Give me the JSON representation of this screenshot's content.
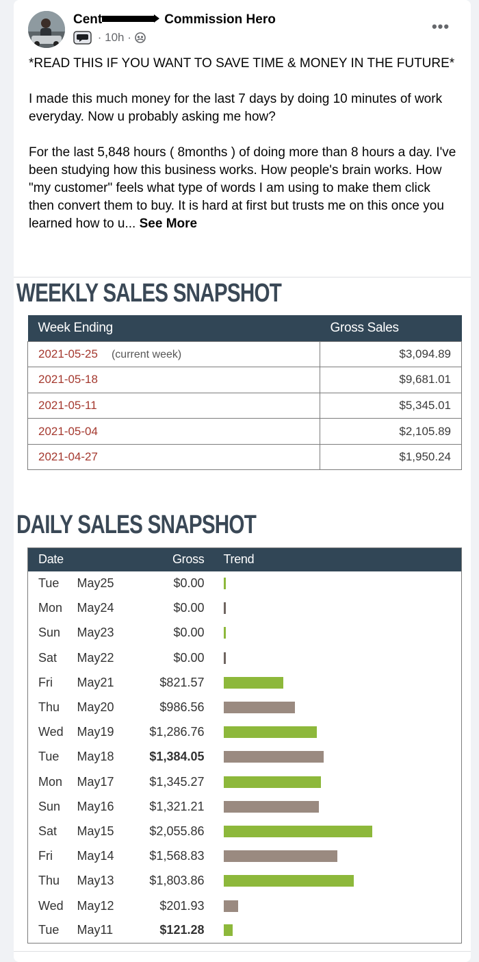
{
  "post": {
    "author_prefix": "Cent",
    "group": "Commission Hero",
    "time": "10h",
    "more_label": "•••",
    "paragraphs": [
      "*READ THIS IF YOU WANT TO SAVE TIME & MONEY IN THE FUTURE*",
      "I made this much money for the last 7 days by doing 10 minutes of work everyday. Now u probably asking me how?",
      "For the last 5,848 hours ( 8months ) of doing more than 8 hours a day. I've been studying how this business works. How people's brain works. How \"my customer\" feels what type of words I am using to make them click then convert them to buy. It is hard at first but trusts me on this once you learned how to u..."
    ],
    "see_more": "See More"
  },
  "weekly": {
    "title": "WEEKLY SALES SNAPSHOT",
    "headers": [
      "Week Ending",
      "Gross Sales"
    ],
    "current_note": "(current week)",
    "rows": [
      {
        "week": "2021-05-25",
        "gross": "$3,094.89"
      },
      {
        "week": "2021-05-18",
        "gross": "$9,681.01"
      },
      {
        "week": "2021-05-11",
        "gross": "$5,345.01"
      },
      {
        "week": "2021-05-04",
        "gross": "$2,105.89"
      },
      {
        "week": "2021-04-27",
        "gross": "$1,950.24"
      }
    ]
  },
  "daily": {
    "title": "DAILY SALES SNAPSHOT",
    "headers": [
      "Date",
      "Gross",
      "Trend"
    ],
    "trend_max_value": 2055.86,
    "rows": [
      {
        "dow": "Tue",
        "date": "May25",
        "gross": "$0.00",
        "value": 0,
        "bold": false,
        "color": "#8db83b"
      },
      {
        "dow": "Mon",
        "date": "May24",
        "gross": "$0.00",
        "value": 0,
        "bold": false,
        "color": "#9a8a80"
      },
      {
        "dow": "Sun",
        "date": "May23",
        "gross": "$0.00",
        "value": 0,
        "bold": false,
        "color": "#8db83b"
      },
      {
        "dow": "Sat",
        "date": "May22",
        "gross": "$0.00",
        "value": 0,
        "bold": false,
        "color": "#9a8a80"
      },
      {
        "dow": "Fri",
        "date": "May21",
        "gross": "$821.57",
        "value": 821.57,
        "bold": false,
        "color": "#8db83b"
      },
      {
        "dow": "Thu",
        "date": "May20",
        "gross": "$986.56",
        "value": 986.56,
        "bold": false,
        "color": "#9a8a80"
      },
      {
        "dow": "Wed",
        "date": "May19",
        "gross": "$1,286.76",
        "value": 1286.76,
        "bold": false,
        "color": "#8db83b"
      },
      {
        "dow": "Tue",
        "date": "May18",
        "gross": "$1,384.05",
        "value": 1384.05,
        "bold": true,
        "color": "#9a8a80"
      },
      {
        "dow": "Mon",
        "date": "May17",
        "gross": "$1,345.27",
        "value": 1345.27,
        "bold": false,
        "color": "#8db83b"
      },
      {
        "dow": "Sun",
        "date": "May16",
        "gross": "$1,321.21",
        "value": 1321.21,
        "bold": false,
        "color": "#9a8a80"
      },
      {
        "dow": "Sat",
        "date": "May15",
        "gross": "$2,055.86",
        "value": 2055.86,
        "bold": false,
        "color": "#8db83b"
      },
      {
        "dow": "Fri",
        "date": "May14",
        "gross": "$1,568.83",
        "value": 1568.83,
        "bold": false,
        "color": "#9a8a80"
      },
      {
        "dow": "Thu",
        "date": "May13",
        "gross": "$1,803.86",
        "value": 1803.86,
        "bold": false,
        "color": "#8db83b"
      },
      {
        "dow": "Wed",
        "date": "May12",
        "gross": "$201.93",
        "value": 201.93,
        "bold": false,
        "color": "#9a8a80"
      },
      {
        "dow": "Tue",
        "date": "May11",
        "gross": "$121.28",
        "value": 121.28,
        "bold": true,
        "color": "#8db83b"
      }
    ]
  }
}
